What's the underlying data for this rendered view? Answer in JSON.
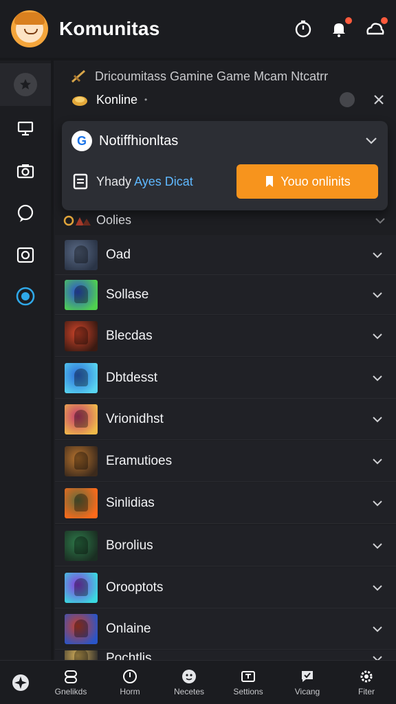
{
  "header": {
    "title": "Komunitas",
    "icons": [
      "timer-icon",
      "bell-icon",
      "cloud-icon"
    ],
    "accent": "#ff5a3c"
  },
  "sidebar": {
    "items": [
      "star-icon",
      "desktop-icon",
      "camera-icon",
      "chat-bubble-icon",
      "screenshot-icon",
      "record-icon"
    ]
  },
  "main": {
    "breadcrumb": "Dricoumitass Gamine Game Mcam Ntcatrr",
    "status": "Konline",
    "status_suffix": "•",
    "notification": {
      "title": "Notiffhionltas",
      "body_prefix": "Yhady",
      "body_accent": "Ayes Dicat",
      "cta_label": "Youo onlinits",
      "cta_color": "#f7941d"
    },
    "section_title": "Oolies",
    "rows": [
      {
        "label": "Oad",
        "color_a": "#5a6a86",
        "color_b": "#2a3446"
      },
      {
        "label": "Sollase",
        "color_a": "#2e4fd1",
        "color_b": "#4fd14f"
      },
      {
        "label": "Blecdas",
        "color_a": "#d2452a",
        "color_b": "#3a1a12"
      },
      {
        "label": "Dbtdesst",
        "color_a": "#2d6bd8",
        "color_b": "#58d4f0"
      },
      {
        "label": "Vrionidhst",
        "color_a": "#c23a6e",
        "color_b": "#f0b94a"
      },
      {
        "label": "Eramutioes",
        "color_a": "#b8742e",
        "color_b": "#3c2a1c"
      },
      {
        "label": "Sinlidias",
        "color_a": "#5e6b3c",
        "color_b": "#ff6a1a"
      },
      {
        "label": "Borolius",
        "color_a": "#2e7a4a",
        "color_b": "#1a2e22"
      },
      {
        "label": "Orooptots",
        "color_a": "#8a3ad8",
        "color_b": "#3ad8e0"
      },
      {
        "label": "Onlaine",
        "color_a": "#c8402a",
        "color_b": "#2a55c8"
      },
      {
        "label": "Pochtlis",
        "color_a": "#d8b25a",
        "color_b": "#2a2a2a"
      }
    ]
  },
  "bottom_nav": {
    "items": [
      {
        "label": "Gnelikds",
        "icon": "controller-icon"
      },
      {
        "label": "Horm",
        "icon": "clock-icon"
      },
      {
        "label": "Necetes",
        "icon": "face-icon"
      },
      {
        "label": "Settions",
        "icon": "grid-icon"
      },
      {
        "label": "Vicang",
        "icon": "message-icon"
      },
      {
        "label": "Fiter",
        "icon": "gear-icon"
      }
    ]
  }
}
